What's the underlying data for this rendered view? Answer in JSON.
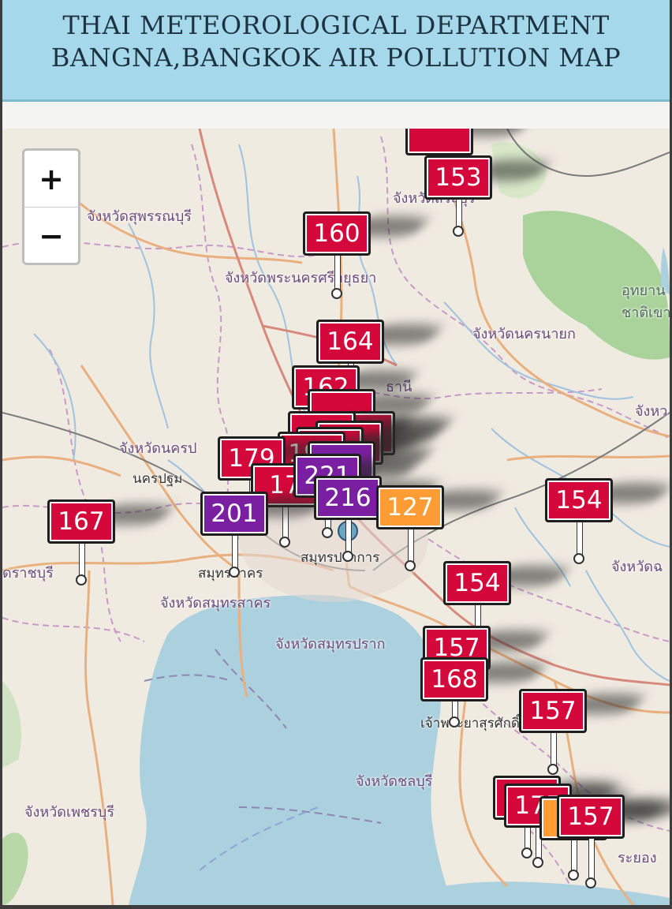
{
  "header": {
    "line1": "THAI METEOROLOGICAL DEPARTMENT",
    "line2": "BANGNA,BANGKOK AIR POLLUTION MAP"
  },
  "zoom": {
    "in_label": "+",
    "out_label": "−"
  },
  "colors": {
    "very_unhealthy": "#d4083a",
    "hazardous": "#7b1fa2",
    "unhealthy_sensitive": "#ff9c33",
    "sea": "#abd0de",
    "land": "#f0ebe1",
    "forest": "#a9d39a"
  },
  "places": [
    {
      "id": "suphanburi",
      "text": "จังหวัดสุพรรณบุรี"
    },
    {
      "id": "ayutthaya",
      "text": "จังหวัดพระนครศรีอยุธยา"
    },
    {
      "id": "top-prov",
      "text": "จังหวัดสระบุรี"
    },
    {
      "id": "nakhon-nayok",
      "text": "จังหวัดนครนายก"
    },
    {
      "id": "park",
      "text": "อุทยาน"
    },
    {
      "id": "park2",
      "text": "ชาติเขา"
    },
    {
      "id": "pathum",
      "text": "ธานี"
    },
    {
      "id": "nakhon-pathom-prov",
      "text": "จังหวัดนครป"
    },
    {
      "id": "nakhon-pathom",
      "text": "นครปฐม"
    },
    {
      "id": "ratchaburi",
      "text": "ดราชบุรี"
    },
    {
      "id": "samut-sakhon",
      "text": "สมุทรสาคร"
    },
    {
      "id": "samut-sakhon-prov",
      "text": "จังหวัดสมุทรสาคร"
    },
    {
      "id": "samut-prakan",
      "text": "สมุทรปราการ"
    },
    {
      "id": "samut-prakan-prov",
      "text": "จังหวัดสมุทรปราก"
    },
    {
      "id": "chachoengsao",
      "text": "จังหวัดฉ"
    },
    {
      "id": "prachin",
      "text": "จังหว"
    },
    {
      "id": "sriracha",
      "text": "เจ้าพระยาสุรศักดิ์"
    },
    {
      "id": "chonburi",
      "text": "จังหวัดชลบุรี"
    },
    {
      "id": "phetchaburi",
      "text": "จังหวัดเพชรบุรี"
    },
    {
      "id": "rayong",
      "text": "ระยอง"
    }
  ],
  "stations": [
    {
      "id": "top-hidden",
      "value": "",
      "level": "very_unhealthy"
    },
    {
      "id": "saraburi",
      "value": "153",
      "level": "very_unhealthy"
    },
    {
      "id": "ayutthaya",
      "value": "160",
      "level": "very_unhealthy"
    },
    {
      "id": "pathum-1",
      "value": "164",
      "level": "very_unhealthy"
    },
    {
      "id": "pathum-2",
      "value": "162",
      "level": "very_unhealthy"
    },
    {
      "id": "bkk-a",
      "value": "",
      "level": "very_unhealthy"
    },
    {
      "id": "bkk-b",
      "value": "",
      "level": "very_unhealthy"
    },
    {
      "id": "bkk-c",
      "value": "",
      "level": "very_unhealthy"
    },
    {
      "id": "bkk-d",
      "value": "",
      "level": "very_unhealthy"
    },
    {
      "id": "bkk-e",
      "value": "",
      "level": "very_unhealthy"
    },
    {
      "id": "bkk-f",
      "value": "192",
      "level": "very_unhealthy"
    },
    {
      "id": "bkk-g",
      "value": "179",
      "level": "very_unhealthy"
    },
    {
      "id": "bkk-h",
      "value": "",
      "level": "hazardous"
    },
    {
      "id": "bkk-i",
      "value": "17",
      "level": "very_unhealthy"
    },
    {
      "id": "bkk-j",
      "value": "221",
      "level": "hazardous"
    },
    {
      "id": "samut-sakhon",
      "value": "201",
      "level": "hazardous"
    },
    {
      "id": "bkk-k",
      "value": "216",
      "level": "hazardous"
    },
    {
      "id": "bang-na",
      "value": "127",
      "level": "unhealthy_sensitive"
    },
    {
      "id": "ratchaburi",
      "value": "167",
      "level": "very_unhealthy"
    },
    {
      "id": "chachoengsao",
      "value": "154",
      "level": "very_unhealthy"
    },
    {
      "id": "chon-1",
      "value": "154",
      "level": "very_unhealthy"
    },
    {
      "id": "chon-2",
      "value": "157",
      "level": "very_unhealthy"
    },
    {
      "id": "chon-3",
      "value": "168",
      "level": "very_unhealthy"
    },
    {
      "id": "rayong-1",
      "value": "157",
      "level": "very_unhealthy"
    },
    {
      "id": "rayong-2",
      "value": "",
      "level": "very_unhealthy"
    },
    {
      "id": "rayong-3",
      "value": "175",
      "level": "very_unhealthy"
    },
    {
      "id": "rayong-4",
      "value": "",
      "level": "unhealthy_sensitive"
    },
    {
      "id": "rayong-5",
      "value": "157",
      "level": "very_unhealthy"
    }
  ]
}
